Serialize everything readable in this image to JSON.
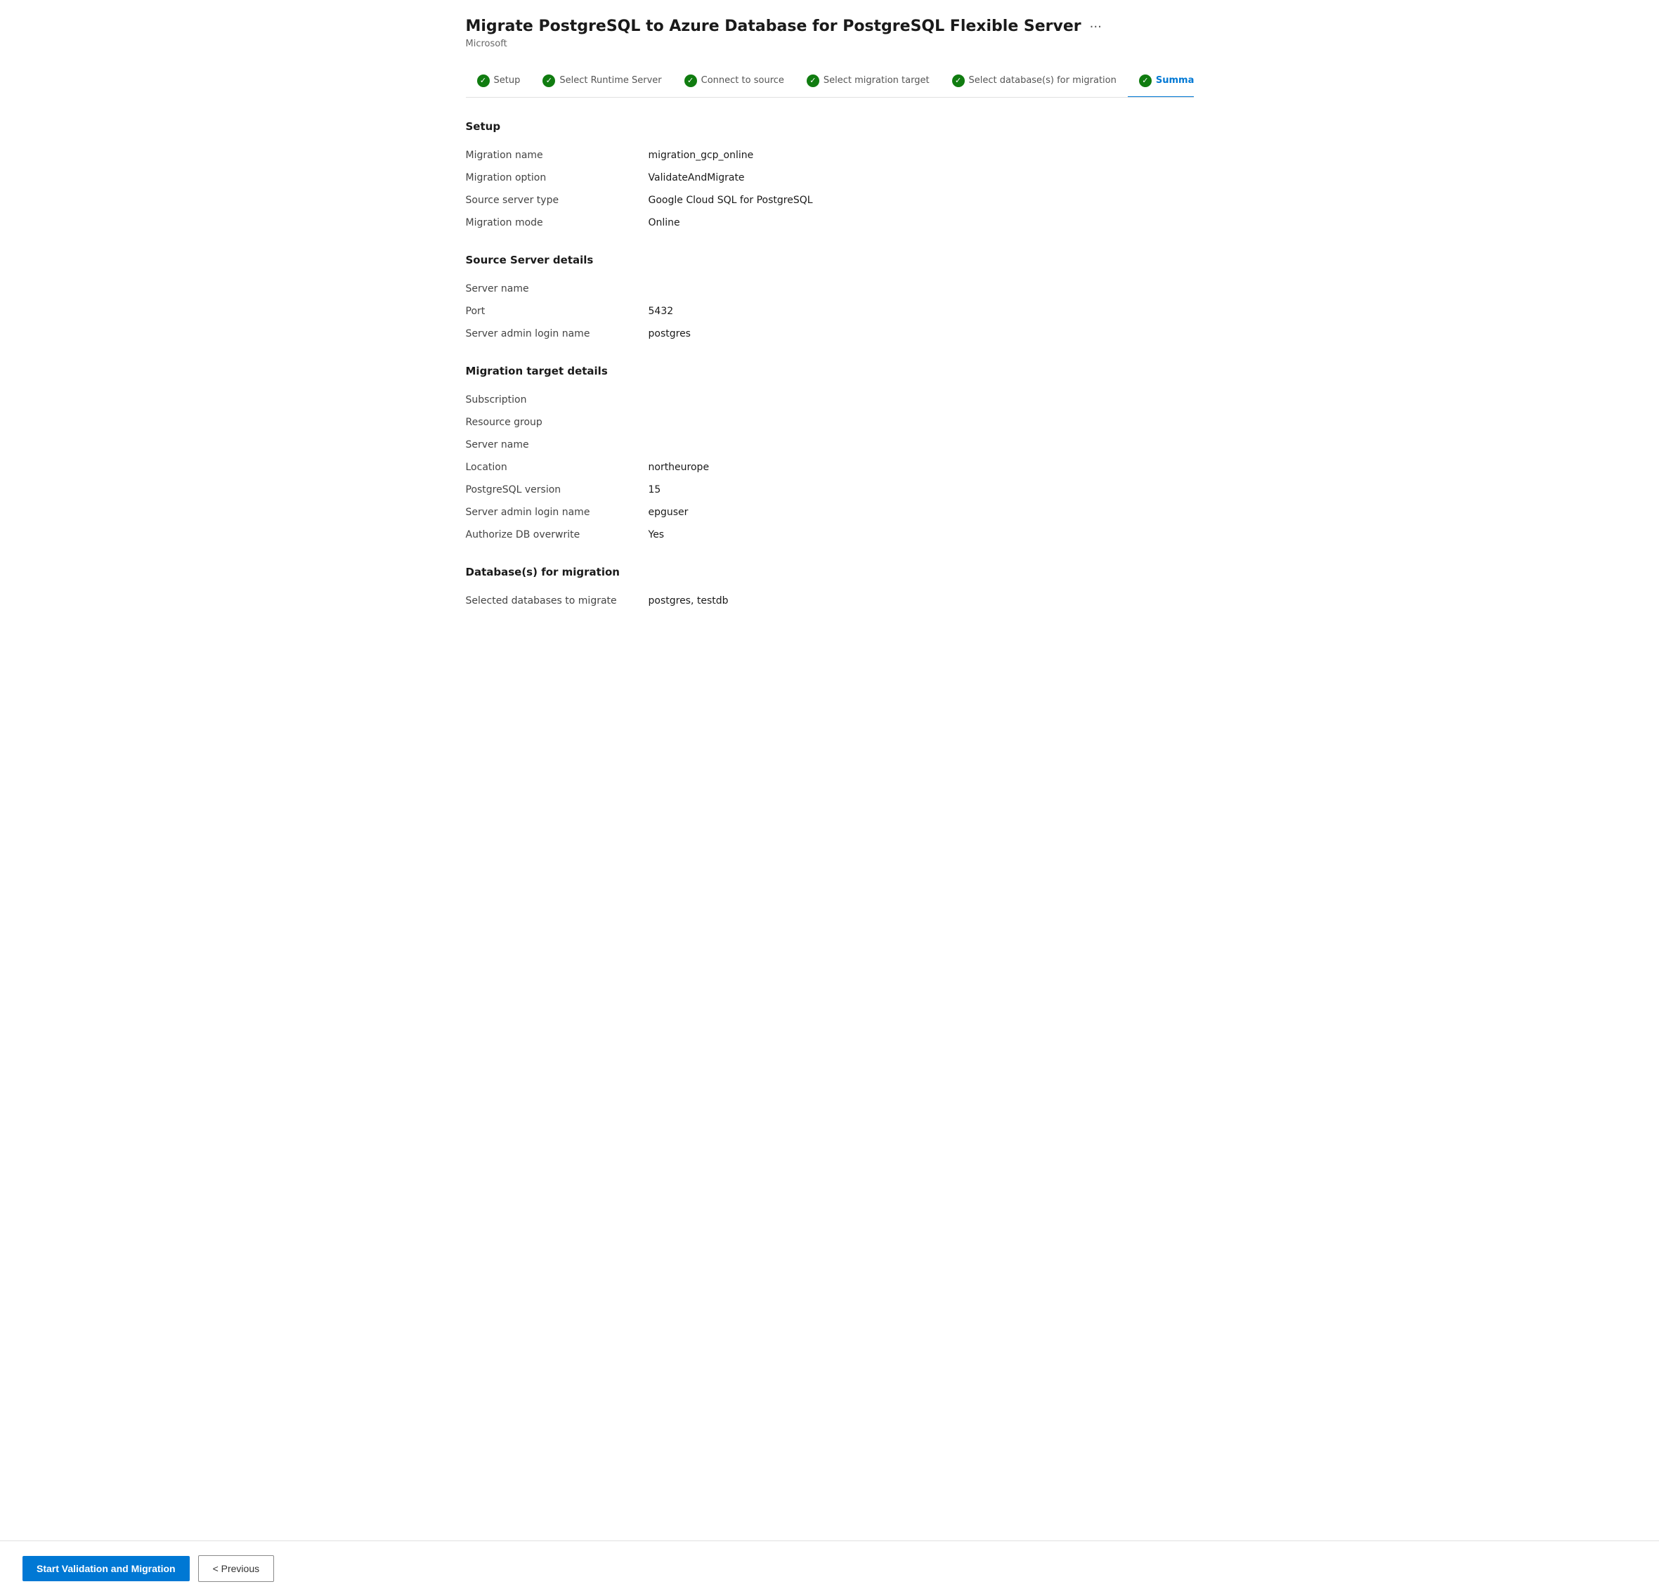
{
  "page": {
    "title": "Migrate PostgreSQL to Azure Database for PostgreSQL Flexible Server",
    "subtitle": "Microsoft",
    "more_icon": "···"
  },
  "wizard": {
    "steps": [
      {
        "id": "setup",
        "label": "Setup",
        "completed": true,
        "active": false
      },
      {
        "id": "runtime-server",
        "label": "Select Runtime Server",
        "completed": true,
        "active": false
      },
      {
        "id": "connect-source",
        "label": "Connect to source",
        "completed": true,
        "active": false
      },
      {
        "id": "migration-target",
        "label": "Select migration target",
        "completed": true,
        "active": false
      },
      {
        "id": "select-databases",
        "label": "Select database(s) for migration",
        "completed": true,
        "active": false
      },
      {
        "id": "summary",
        "label": "Summary",
        "completed": true,
        "active": true
      }
    ]
  },
  "sections": {
    "setup": {
      "title": "Setup",
      "fields": [
        {
          "label": "Migration name",
          "value": "migration_gcp_online"
        },
        {
          "label": "Migration option",
          "value": "ValidateAndMigrate"
        },
        {
          "label": "Source server type",
          "value": "Google Cloud SQL for PostgreSQL"
        },
        {
          "label": "Migration mode",
          "value": "Online"
        }
      ]
    },
    "source_server": {
      "title": "Source Server details",
      "fields": [
        {
          "label": "Server name",
          "value": ""
        },
        {
          "label": "Port",
          "value": "5432"
        },
        {
          "label": "Server admin login name",
          "value": "postgres"
        }
      ]
    },
    "migration_target": {
      "title": "Migration target details",
      "fields": [
        {
          "label": "Subscription",
          "value": ""
        },
        {
          "label": "Resource group",
          "value": ""
        },
        {
          "label": "Server name",
          "value": ""
        },
        {
          "label": "Location",
          "value": "northeurope"
        },
        {
          "label": "PostgreSQL version",
          "value": "15"
        },
        {
          "label": "Server admin login name",
          "value": "epguser"
        },
        {
          "label": "Authorize DB overwrite",
          "value": "Yes"
        }
      ]
    },
    "databases": {
      "title": "Database(s) for migration",
      "fields": [
        {
          "label": "Selected databases to migrate",
          "value": "postgres, testdb"
        }
      ]
    }
  },
  "footer": {
    "start_button_label": "Start Validation and Migration",
    "previous_button_label": "< Previous"
  }
}
